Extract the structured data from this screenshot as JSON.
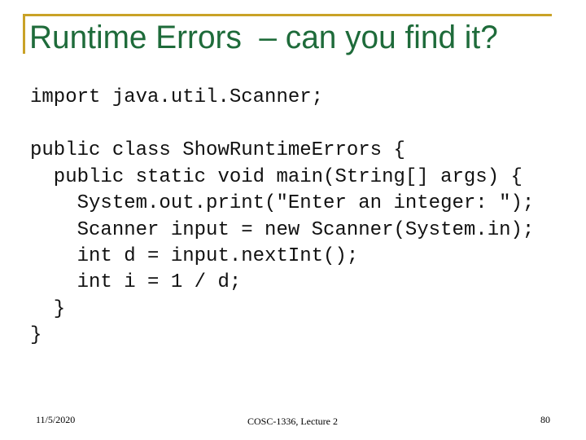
{
  "slide": {
    "title": "Runtime Errors  – can you find it?",
    "code_lines": [
      "import java.util.Scanner;",
      "",
      "public class ShowRuntimeErrors {",
      "  public static void main(String[] args) {",
      "    System.out.print(\"Enter an integer: \");",
      "    Scanner input = new Scanner(System.in);",
      "    int d = input.nextInt();",
      "    int i = 1 / d;",
      "  }",
      "}"
    ],
    "footer": {
      "date": "11/5/2020",
      "course": "COSC-1336, Lecture 2",
      "page_number": "80"
    },
    "colors": {
      "title": "#1E6B3A",
      "accent_rule": "#C9A227"
    }
  }
}
